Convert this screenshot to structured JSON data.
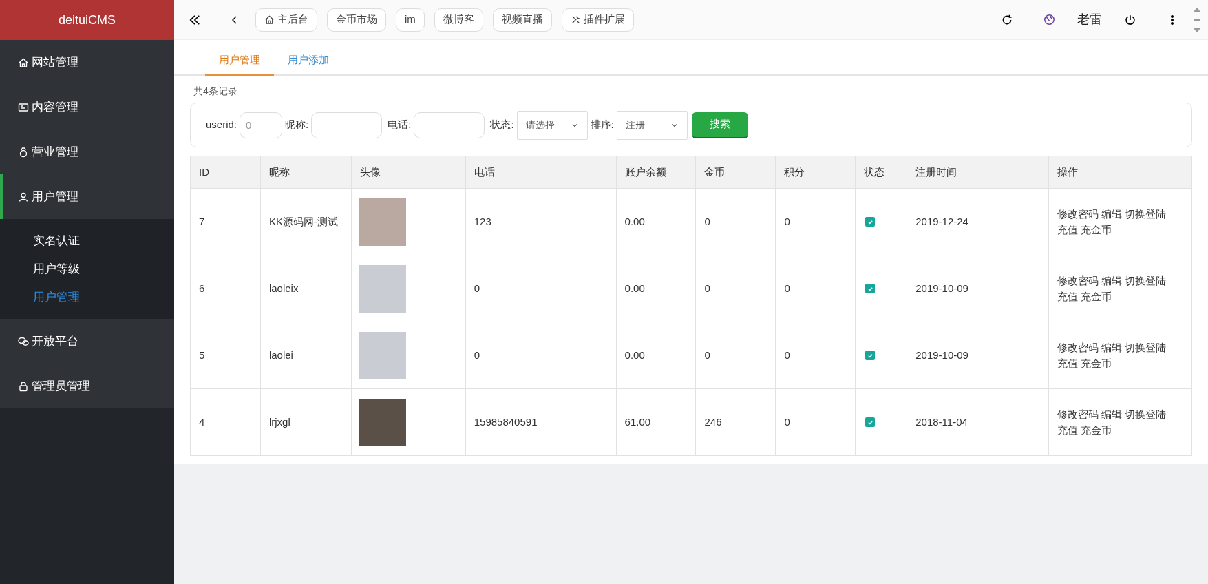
{
  "sidebar": {
    "brand": "deituiCMS",
    "items": [
      {
        "label": "网站管理",
        "expanded": false
      },
      {
        "label": "内容管理",
        "expanded": false
      },
      {
        "label": "营业管理",
        "expanded": false
      },
      {
        "label": "用户管理",
        "expanded": true,
        "children": [
          {
            "label": "实名认证",
            "selected": false
          },
          {
            "label": "用户等级",
            "selected": false
          },
          {
            "label": "用户管理",
            "selected": true
          }
        ]
      },
      {
        "label": "开放平台",
        "expanded": false
      },
      {
        "label": "管理员管理",
        "expanded": false
      }
    ]
  },
  "topbar": {
    "shortcuts": [
      {
        "label": "主后台"
      },
      {
        "label": "金币市场"
      },
      {
        "label": "im"
      },
      {
        "label": "微博客"
      },
      {
        "label": "视频直播"
      },
      {
        "label": "插件扩展"
      }
    ],
    "user": "老雷"
  },
  "tabs": [
    {
      "label": "用户管理",
      "selected": true
    },
    {
      "label": "用户添加",
      "selected": false
    }
  ],
  "record_count": "共4条记录",
  "filters": [
    {
      "kind": "input",
      "label": "userid:",
      "placeholder": "0"
    },
    {
      "kind": "input",
      "label": "昵称:"
    },
    {
      "kind": "input",
      "label": "电话:"
    },
    {
      "kind": "select",
      "label": "状态:",
      "value": "请选择"
    },
    {
      "kind": "select",
      "label": "排序:",
      "value": "注册"
    }
  ],
  "search_button": "搜索",
  "table": {
    "columns": [
      "ID",
      "昵称",
      "头像",
      "电话",
      "账户余额",
      "金币",
      "积分",
      "状态",
      "注册时间",
      "操作"
    ],
    "rows": [
      {
        "id": "7",
        "nickname": "KK源码网-测试",
        "phone": "123",
        "balance": "0.00",
        "coins": "0",
        "points": "0",
        "checked": true,
        "date": "2019-12-24",
        "actions": [
          "修改密码",
          "编辑",
          "切换登陆",
          "充值",
          "充金币"
        ]
      },
      {
        "id": "6",
        "nickname": "laoleix",
        "phone": "0",
        "balance": "0.00",
        "coins": "0",
        "points": "0",
        "checked": true,
        "date": "2019-10-09",
        "actions": [
          "修改密码",
          "编辑",
          "切换登陆",
          "充值",
          "充金币"
        ]
      },
      {
        "id": "5",
        "nickname": "laolei",
        "phone": "0",
        "balance": "0.00",
        "coins": "0",
        "points": "0",
        "checked": true,
        "date": "2019-10-09",
        "actions": [
          "修改密码",
          "编辑",
          "切换登陆",
          "充值",
          "充金币"
        ]
      },
      {
        "id": "4",
        "nickname": "lrjxgl",
        "phone": "15985840591",
        "balance": "61.00",
        "coins": "246",
        "points": "0",
        "checked": true,
        "date": "2018-11-04",
        "actions": [
          "修改密码",
          "编辑",
          "切换登陆",
          "充值",
          "充金币"
        ]
      }
    ]
  }
}
